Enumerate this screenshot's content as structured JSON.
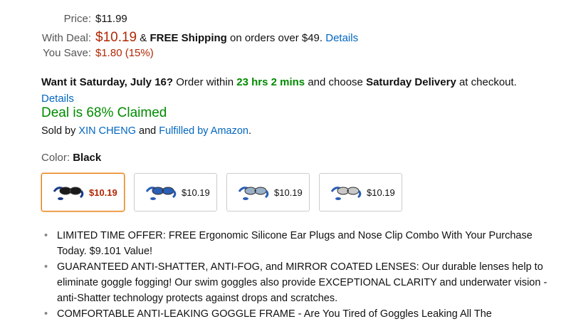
{
  "pricing": {
    "price_label": "Price:",
    "price_value": "$11.99",
    "deal_label": "With Deal:",
    "deal_value": "$10.19",
    "free_shipping_prefix": "&",
    "free_shipping": "FREE Shipping",
    "shipping_suffix": "on orders over $49.",
    "details_link": "Details",
    "save_label": "You Save:",
    "save_value": "$1.80 (15%)"
  },
  "delivery": {
    "prefix": "Want it Saturday, July 16?",
    "middle": "Order within",
    "countdown": "23 hrs 2 mins",
    "and_choose": "and choose",
    "option": "Saturday Delivery",
    "suffix": "at checkout.",
    "details_link": "Details"
  },
  "deal_status": "Deal is 68% Claimed",
  "seller": {
    "sold_by": "Sold by",
    "seller_name": "XIN CHENG",
    "and": "and",
    "fulfilled": "Fulfilled by Amazon",
    "period": "."
  },
  "color": {
    "label": "Color:",
    "selected": "Black"
  },
  "swatches": [
    {
      "price": "$10.19",
      "selected": true,
      "lens_color": "#1a1a1a",
      "strap_color": "#1a3a8a"
    },
    {
      "price": "$10.19",
      "selected": false,
      "lens_color": "#2a5fb5",
      "strap_color": "#2a5fb5"
    },
    {
      "price": "$10.19",
      "selected": false,
      "lens_color": "#9ab0c8",
      "strap_color": "#2a5fb5"
    },
    {
      "price": "$10.19",
      "selected": false,
      "lens_color": "#c8c8c8",
      "strap_color": "#2a5fb5"
    }
  ],
  "bullets": [
    "LIMITED TIME OFFER: FREE Ergonomic Silicone Ear Plugs and Nose Clip Combo With Your Purchase Today. $9.101 Value!",
    "GUARANTEED ANTI-SHATTER, ANTI-FOG, and MIRROR COATED LENSES: Our durable lenses help to eliminate goggle fogging! Our swim goggles also provide EXCEPTIONAL CLARITY and underwater vision - anti-Shatter technology protects against drops and scratches.",
    "COMFORTABLE ANTI-LEAKING GOGGLE FRAME - Are You Tired of Goggles Leaking All The"
  ],
  "colors": {
    "price_red": "#B12704",
    "link_blue": "#0066c0",
    "deal_green": "#008a00",
    "selected_border": "#e77600"
  }
}
